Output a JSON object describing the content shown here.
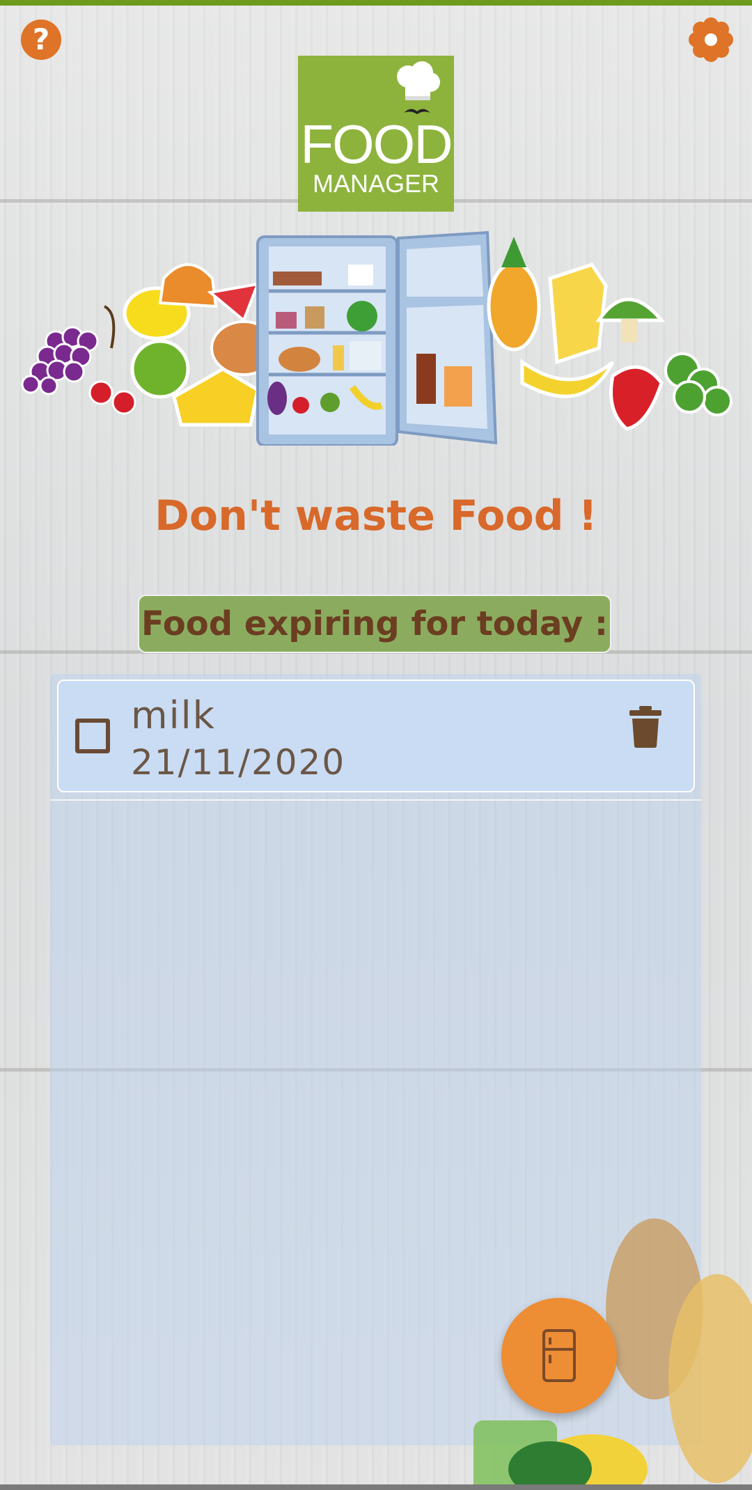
{
  "header": {
    "help_icon": "question-mark-icon",
    "help_glyph": "?",
    "settings_icon": "flower-gear-icon"
  },
  "logo": {
    "line1": "FOOD",
    "line2": "MANAGER"
  },
  "slogan": "Don't waste Food !",
  "section_title": "Food expiring for today :",
  "food_items": [
    {
      "name": "milk",
      "date": "21/11/2020",
      "checked": false
    }
  ],
  "fab": {
    "icon": "fridge-icon"
  },
  "colors": {
    "accent_orange": "#d8692a",
    "fab_orange": "#ed8d34",
    "logo_green": "#8db33d",
    "subtitle_green": "#8bac5f",
    "brown_text": "#6b3d21",
    "item_blue": "#c9dcf3",
    "top_bar_green": "#6e9a1e"
  }
}
